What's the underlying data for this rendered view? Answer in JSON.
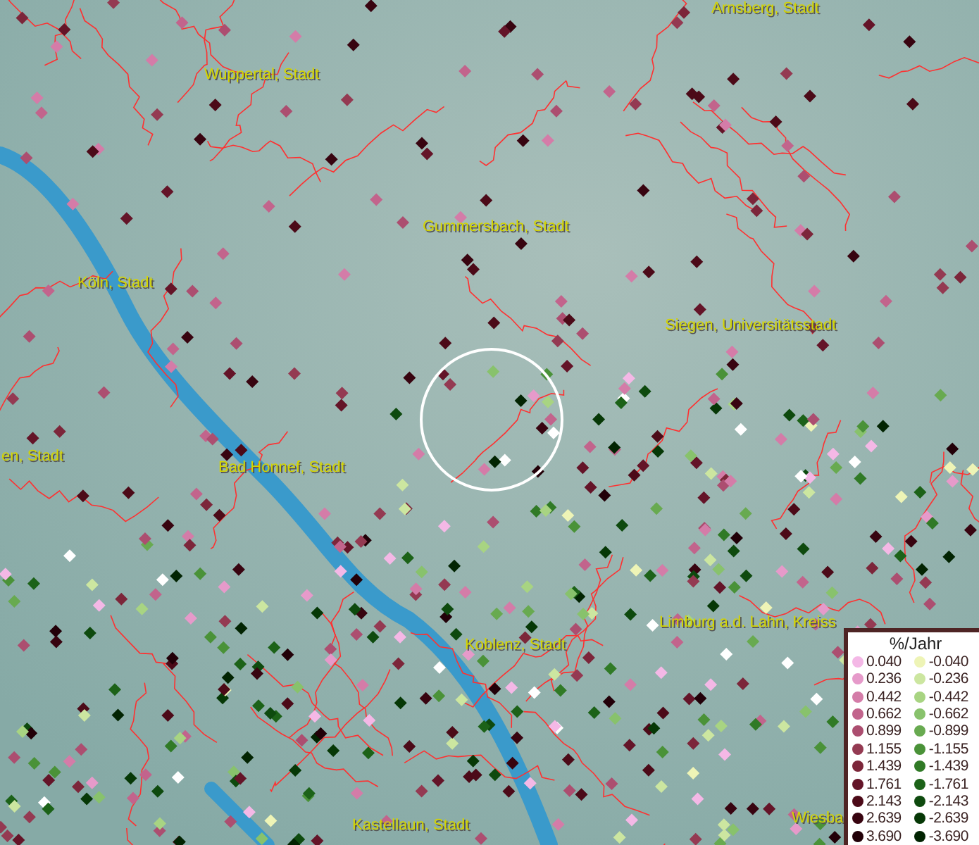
{
  "map": {
    "place_labels": [
      {
        "text": "Arnsberg, Stadt"
      },
      {
        "text": "Wuppertal, Stadt"
      },
      {
        "text": "Gummersbach, Stadt"
      },
      {
        "text": "Köln, Stadt"
      },
      {
        "text": "Siegen, Universitätsstadt"
      },
      {
        "text": "en, Stadt"
      },
      {
        "text": "Bad Honnef, Stadt"
      },
      {
        "text": "Koblenz, Stadt"
      },
      {
        "text": "Limburg a.d. Lahn, Kreiss"
      },
      {
        "text": "Kastellaun, Stadt"
      },
      {
        "text": "Wiesba"
      }
    ]
  },
  "legend": {
    "title": "%/Jahr",
    "positive": [
      {
        "label": "0.040",
        "color": "#f4b8e6"
      },
      {
        "label": "0.236",
        "color": "#e69aca"
      },
      {
        "label": "0.442",
        "color": "#d47ca8"
      },
      {
        "label": "0.662",
        "color": "#c2648c"
      },
      {
        "label": "0.899",
        "color": "#ac4e70"
      },
      {
        "label": "1.155",
        "color": "#943a52"
      },
      {
        "label": "1.439",
        "color": "#7c263a"
      },
      {
        "label": "1.761",
        "color": "#641428"
      },
      {
        "label": "2.143",
        "color": "#4c0a18"
      },
      {
        "label": "2.639",
        "color": "#380410"
      },
      {
        "label": "3.690",
        "color": "#220008"
      }
    ],
    "negative": [
      {
        "label": "-0.040",
        "color": "#eef4b6"
      },
      {
        "label": "-0.236",
        "color": "#cce6a0"
      },
      {
        "label": "-0.442",
        "color": "#a8d482"
      },
      {
        "label": "-0.662",
        "color": "#88c26c"
      },
      {
        "label": "-0.899",
        "color": "#68aa50"
      },
      {
        "label": "-1.155",
        "color": "#4a9238"
      },
      {
        "label": "-1.439",
        "color": "#307a26"
      },
      {
        "label": "-1.761",
        "color": "#1c6218"
      },
      {
        "label": "-2.143",
        "color": "#0e4a0e"
      },
      {
        "label": "-2.639",
        "color": "#063806"
      },
      {
        "label": "-3.690",
        "color": "#022402"
      }
    ]
  }
}
